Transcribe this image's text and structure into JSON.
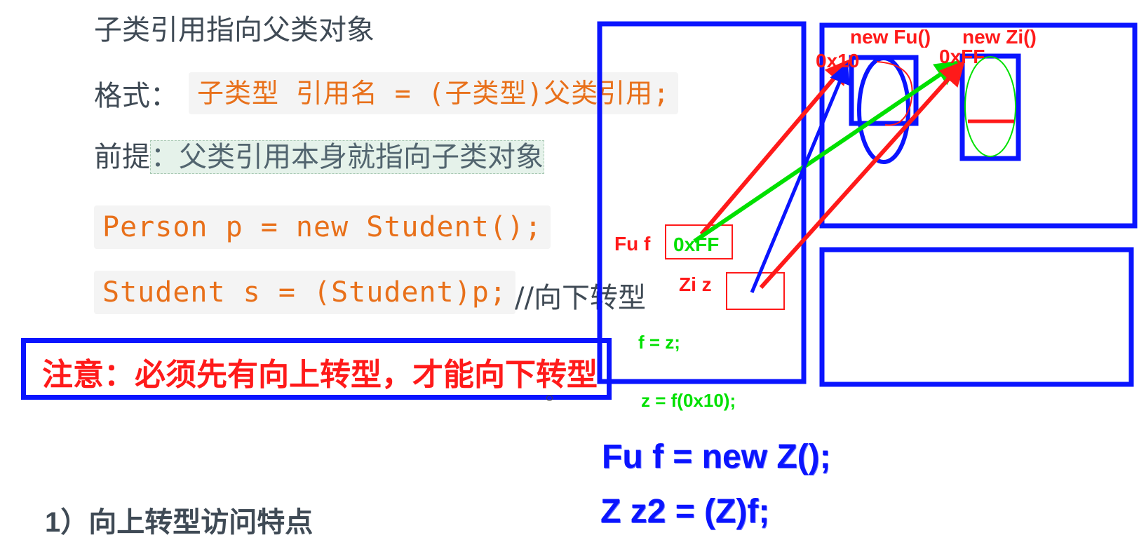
{
  "slide": {
    "heading": "子类引用指向父类对象",
    "format_label": "格式：",
    "format_code": "子类型 引用名 = (子类型)父类引用;",
    "premise_label": "前提",
    "premise_text": "：父类引用本身就指向子类对象",
    "code_line_1": "Person p = new Student();",
    "code_line_2": "Student s = (Student)p;",
    "code_comment": "//向下转型",
    "note": "注意：必须先有向上转型，才能向下转型",
    "sub_heading": "1）向上转型访问特点"
  },
  "diagram": {
    "label_new_fu": "new Fu()",
    "label_new_zi": "new Zi()",
    "label_addr_fu": "0x10",
    "label_addr_zi": "0xFF",
    "label_var_f": "Fu f",
    "label_var_f_value": "0xFF",
    "label_var_z": "Zi z",
    "label_assign_1": "f = z;",
    "label_assign_2": "z = f(0x10);",
    "code_big_1": "Fu f = new Z();",
    "code_big_2": "Z z2 = (Z)f;",
    "colors": {
      "box_outline": "#0a14ff",
      "arrow_red": "#ff1a1a",
      "arrow_green": "#00e000",
      "arrow_blue": "#0a14ff"
    }
  }
}
